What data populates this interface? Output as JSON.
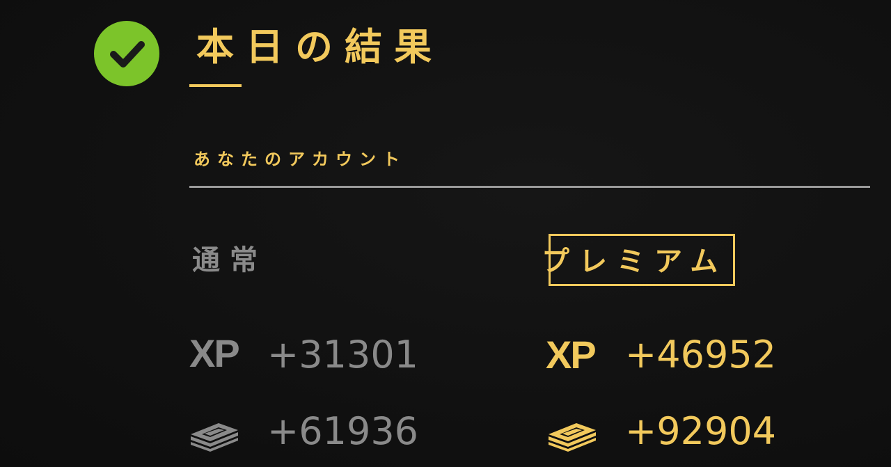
{
  "header": {
    "title": "本日の結果"
  },
  "account": {
    "section_label": "あなたのアカウント"
  },
  "columns": {
    "normal": {
      "title": "通常",
      "xp_label": "XP",
      "xp_value": "+31301",
      "cash_value": "+61936"
    },
    "premium": {
      "title": "プレミアム",
      "xp_label": "XP",
      "xp_value": "+46952",
      "cash_value": "+92904"
    }
  },
  "icons": {
    "status": "check-icon",
    "currency": "cash-stack-icon"
  },
  "colors": {
    "background": "#111111",
    "accent_gold": "#f2c95c",
    "muted_gray": "#8a8a8a",
    "check_green": "#7cc42a"
  }
}
